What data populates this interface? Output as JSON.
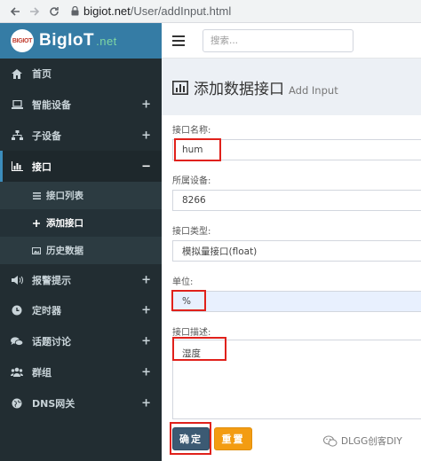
{
  "browser": {
    "url_host": "bigiot.net",
    "url_path": "/User/addInput.html"
  },
  "brand": {
    "badge": "BIGIOT",
    "name": "BigIoT",
    "suffix": ".net"
  },
  "sidebar": {
    "items": [
      {
        "label": "首页",
        "icon": "home-icon",
        "expandable": false
      },
      {
        "label": "智能设备",
        "icon": "laptop-icon",
        "expandable": true
      },
      {
        "label": "子设备",
        "icon": "sitemap-icon",
        "expandable": true
      },
      {
        "label": "接口",
        "icon": "bar-chart-icon",
        "expandable": true,
        "active": true
      },
      {
        "label": "报警提示",
        "icon": "volume-icon",
        "expandable": true
      },
      {
        "label": "定时器",
        "icon": "clock-icon",
        "expandable": true
      },
      {
        "label": "话题讨论",
        "icon": "comments-icon",
        "expandable": true
      },
      {
        "label": "群组",
        "icon": "group-icon",
        "expandable": true
      },
      {
        "label": "DNS网关",
        "icon": "globe-icon",
        "expandable": true
      }
    ],
    "submenu": [
      {
        "label": "接口列表",
        "icon": "list-icon"
      },
      {
        "label": "添加接口",
        "icon": "plus-icon",
        "current": true
      },
      {
        "label": "历史数据",
        "icon": "image-icon"
      }
    ],
    "expand_symbol": "+",
    "collapse_symbol": "−"
  },
  "header": {
    "search_placeholder": "搜索..."
  },
  "page": {
    "title": "添加数据接口",
    "subtitle": "Add Input"
  },
  "form": {
    "name_label": "接口名称:",
    "name_value": "hum",
    "device_label": "所属设备:",
    "device_value": "8266",
    "type_label": "接口类型:",
    "type_value": "模拟量接口(float)",
    "unit_label": "单位:",
    "unit_value": "%",
    "desc_label": "接口描述:",
    "desc_value": "湿度",
    "submit_label": "确定",
    "reset_label": "重置"
  },
  "watermark": {
    "text": "DLGG创客DIY"
  },
  "colors": {
    "sidebar_bg": "#222d32",
    "logo_bg": "#357ca5",
    "accent": "#3c8dbc",
    "highlight_box": "#e0211b",
    "reset_button": "#f39c12"
  }
}
